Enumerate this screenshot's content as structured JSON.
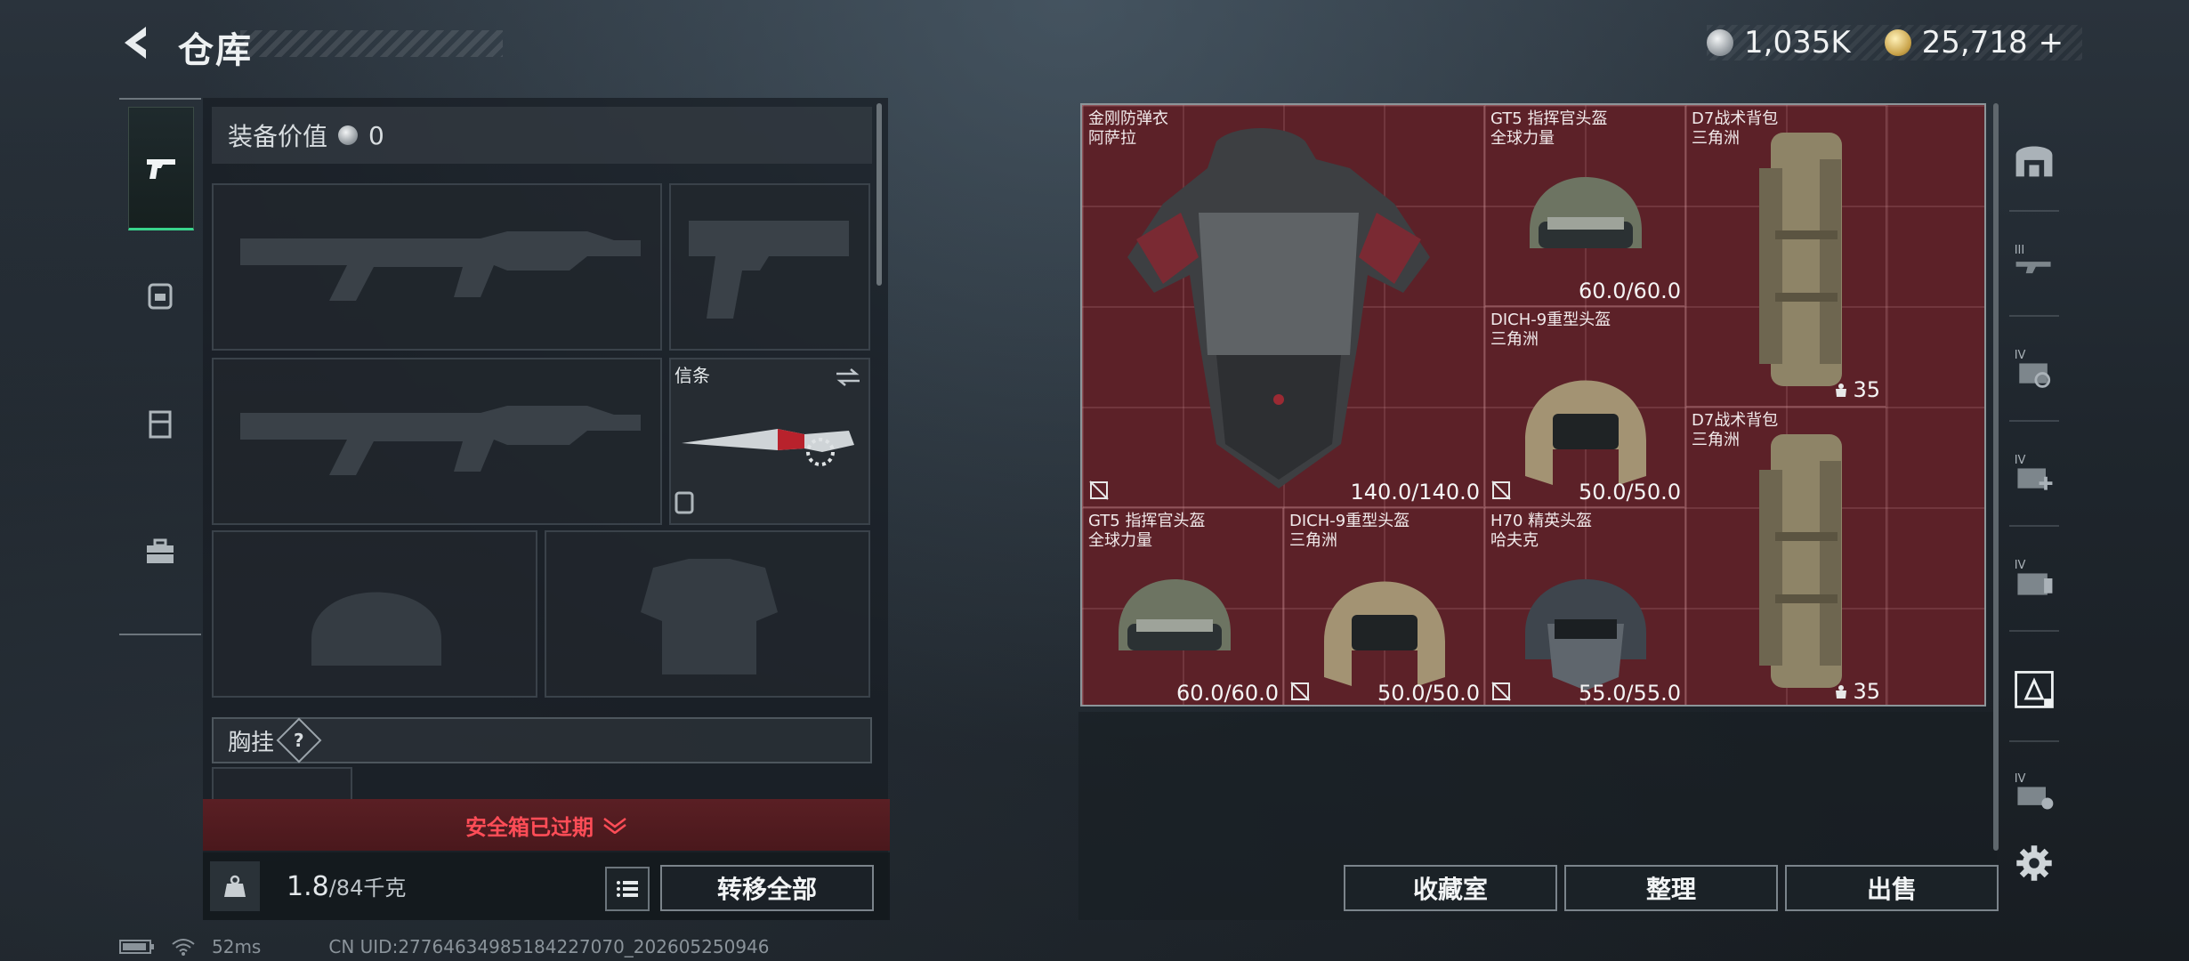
{
  "header": {
    "title": "仓库",
    "silver": "1,035K",
    "gold": "25,718",
    "gold_plus": "+"
  },
  "left_tabs": [
    {
      "icon": "pistol-icon",
      "active": true
    },
    {
      "icon": "backpack-icon",
      "active": false
    },
    {
      "icon": "rig-icon",
      "active": false
    },
    {
      "icon": "toolbox-icon",
      "active": false
    }
  ],
  "equipment": {
    "value_label": "装备价值",
    "value": "0",
    "knife_label": "信条",
    "chest_rig_label": "胸挂",
    "chest_rig_help": "?"
  },
  "safe_box": {
    "label": "安全箱已过期"
  },
  "weight": {
    "current": "1.8",
    "max": "/84千克"
  },
  "buttons": {
    "transfer_all": "转移全部",
    "collection": "收藏室",
    "organize": "整理",
    "sell": "出售"
  },
  "stash_items": [
    {
      "name": "金刚防弹衣\n阿萨拉",
      "durability": "140.0/140.0",
      "icon": "body-armor-icon"
    },
    {
      "name": "GT5 指挥官头盔\n全球力量",
      "durability": "60.0/60.0",
      "icon": "helmet-icon"
    },
    {
      "name": "D7战术背包\n三角洲",
      "capacity": "35",
      "icon": "backpack-icon"
    },
    {
      "name": "DICH-9重型头盔\n三角洲",
      "durability": "50.0/50.0",
      "icon": "helmet-icon"
    },
    {
      "name": "D7战术背包\n三角洲",
      "capacity": "35",
      "icon": "backpack-icon"
    },
    {
      "name": "GT5 指挥官头盔\n全球力量",
      "durability": "60.0/60.0",
      "icon": "helmet-icon"
    },
    {
      "name": "DICH-9重型头盔\n三角洲",
      "durability": "50.0/50.0",
      "icon": "helmet-icon"
    },
    {
      "name": "H70 精英头盔\n哈夫克",
      "durability": "55.0/55.0",
      "icon": "helmet-icon"
    }
  ],
  "right_tools": [
    {
      "icon": "vault-icon",
      "level": ""
    },
    {
      "icon": "weapon-rack-icon",
      "level": "III"
    },
    {
      "icon": "recycle-storage-icon",
      "level": "IV"
    },
    {
      "icon": "medical-storage-icon",
      "level": "IV"
    },
    {
      "icon": "document-storage-icon",
      "level": "IV"
    },
    {
      "icon": "armor-storage-icon",
      "level": ""
    },
    {
      "icon": "ammo-storage-icon",
      "level": "IV"
    },
    {
      "icon": "gear-icon",
      "level": ""
    }
  ],
  "status": {
    "ping": "52ms",
    "uid": "CN UID:27764634985184227070_202605250946"
  },
  "colors": {
    "stash_bg": "#5c2128",
    "safe_red": "#ff4d57",
    "active_green": "#39d38c"
  }
}
